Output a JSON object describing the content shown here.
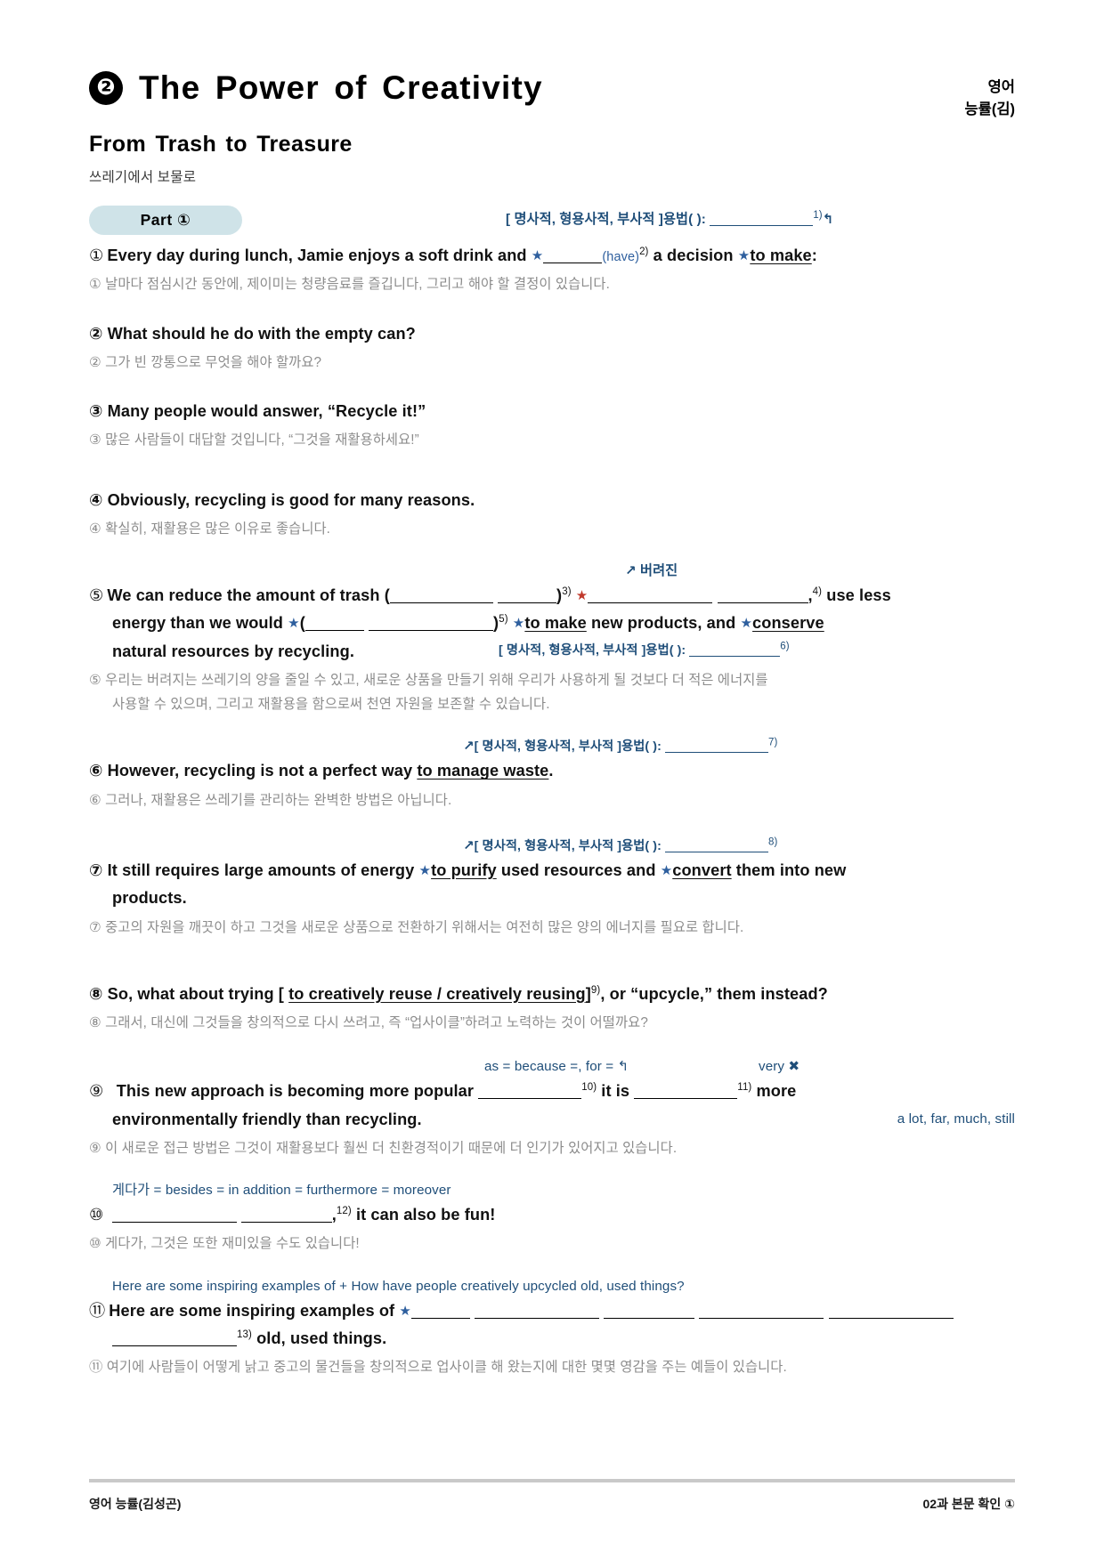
{
  "header": {
    "lesson_number": "❷",
    "lesson_title": "The Power of Creativity",
    "subject_line1": "영어",
    "subject_line2": "능률(김)"
  },
  "passage": {
    "title": "From Trash to Treasure",
    "subtitle": "쓰레기에서 보물로",
    "part_label": "Part ①"
  },
  "colors": {
    "accent_blue": "#1f4e79",
    "star_blue": "#2e5f9e",
    "star_red": "#c0392b",
    "pill_bg": "#cfe3e8",
    "ko_gray": "#8c8c8c"
  },
  "notes": {
    "usage_template": "[ 명사적, 형용사적, 부사적 ]용법(          ): ",
    "n1_sup": "1)",
    "n6_sup": "6)",
    "n7_sup": "7)",
    "n8_sup": "8)",
    "discarded": "버려진",
    "as_because_for": "as = because =, for =",
    "very": "very",
    "adverbs_list": "a lot, far, much, still",
    "besides_list": "게다가 = besides = in addition = furthermore = moreover",
    "here_are_hint": "Here are some inspiring examples of + How have people creatively upcycled old, used things?"
  },
  "sentences": [
    {
      "num": "①",
      "en_pre": "Every day during lunch, Jamie enjoys a soft drink and ",
      "en_hint": "(have)",
      "en_sup": "2)",
      "en_mid": " a decision ",
      "en_answer": "to make",
      "en_post": ":",
      "ko": "① 날마다 점심시간 동안에, 제이미는 청량음료를 즐깁니다, 그리고 해야 할 결정이 있습니다."
    },
    {
      "num": "②",
      "en": "② What should he do with the empty can?",
      "ko": "② 그가 빈 깡통으로 무엇을 해야 할까요?"
    },
    {
      "num": "③",
      "en": "③ Many people would answer, “Recycle it!”",
      "ko": "③ 많은 사람들이 대답할 것입니다, “그것을 재활용하세요!”"
    },
    {
      "num": "④",
      "en": "④ Obviously, recycling is good for many reasons.",
      "ko": "④ 확실히, 재활용은 많은 이유로 좋습니다."
    },
    {
      "num": "⑤",
      "en_l1_a": "We can reduce the amount of trash (",
      "en_l1_sup3": "3)",
      "en_l1_sup4": "4)",
      "en_l1_b": " use less",
      "en_l2_a": "energy than we would ",
      "en_l2_sup5": "5)",
      "en_l2_answer": "to make",
      "en_l2_b": " new products, and ",
      "en_l2_c": "conserve",
      "en_l3": "natural resources by recycling.",
      "ko_l1": "⑤ 우리는 버려지는 쓰레기의 양을 줄일 수 있고, 새로운 상품을 만들기 위해 우리가 사용하게 될 것보다 더 적은 에너지를",
      "ko_l2": "사용할 수 있으며, 그리고 재활용을 함으로써 천연 자원을 보존할 수 있습니다."
    },
    {
      "num": "⑥",
      "en_pre": "⑥ However, recycling is not a perfect way ",
      "en_answer": "to manage waste",
      "en_post": ".",
      "ko": "⑥ 그러나, 재활용은 쓰레기를 관리하는 완벽한 방법은 아닙니다."
    },
    {
      "num": "⑦",
      "en_pre": "⑦ It still requires large amounts of energy ",
      "en_answer1": "to purify",
      "en_mid": " used resources and ",
      "en_answer2": "convert",
      "en_post": " them into new",
      "en_l2": "products.",
      "ko": "⑦ 중고의 자원을 깨끗이 하고 그것을 새로운 상품으로 전환하기 위해서는 여전히 많은 양의 에너지를 필요로 합니다."
    },
    {
      "num": "⑧",
      "en_pre": "⑧ So, what about trying [ ",
      "en_answer": "to creatively reuse / creatively reusing",
      "en_sup": "9)",
      "en_post": " ], or “upcycle,” them instead?",
      "ko": "⑧ 그래서, 대신에 그것들을 창의적으로 다시 쓰려고, 즉 “업사이클”하려고 노력하는 것이 어떨까요?"
    },
    {
      "num": "⑨",
      "en_l1_a": "This new approach is becoming more popular ",
      "en_sup10": "10)",
      "en_l1_b": " it is ",
      "en_sup11": "11)",
      "en_l1_c": " more",
      "en_l2": "environmentally friendly than   recycling.",
      "ko": "⑨ 이 새로운 접근 방법은 그것이 재활용보다 훨씬 더 친환경적이기 때문에 더 인기가 있어지고 있습니다."
    },
    {
      "num": "⑩",
      "en_sup12": "12)",
      "en_post": " it can also be fun!",
      "ko": "⑩ 게다가, 그것은 또한 재미있을 수도 있습니다!"
    },
    {
      "num": "⑪",
      "en_l1": "Here are some inspiring examples of ",
      "en_sup13": "13)",
      "en_l2": " old, used things.",
      "ko": "⑪ 여기에 사람들이 어떻게 낡고 중고의 물건들을 창의적으로 업사이클 해 왔는지에 대한 몇몇 영감을 주는 예들이 있습니다."
    }
  ],
  "footer": {
    "left": "영어 능률(김성곤)",
    "right": "02과 본문 확인 ①"
  }
}
